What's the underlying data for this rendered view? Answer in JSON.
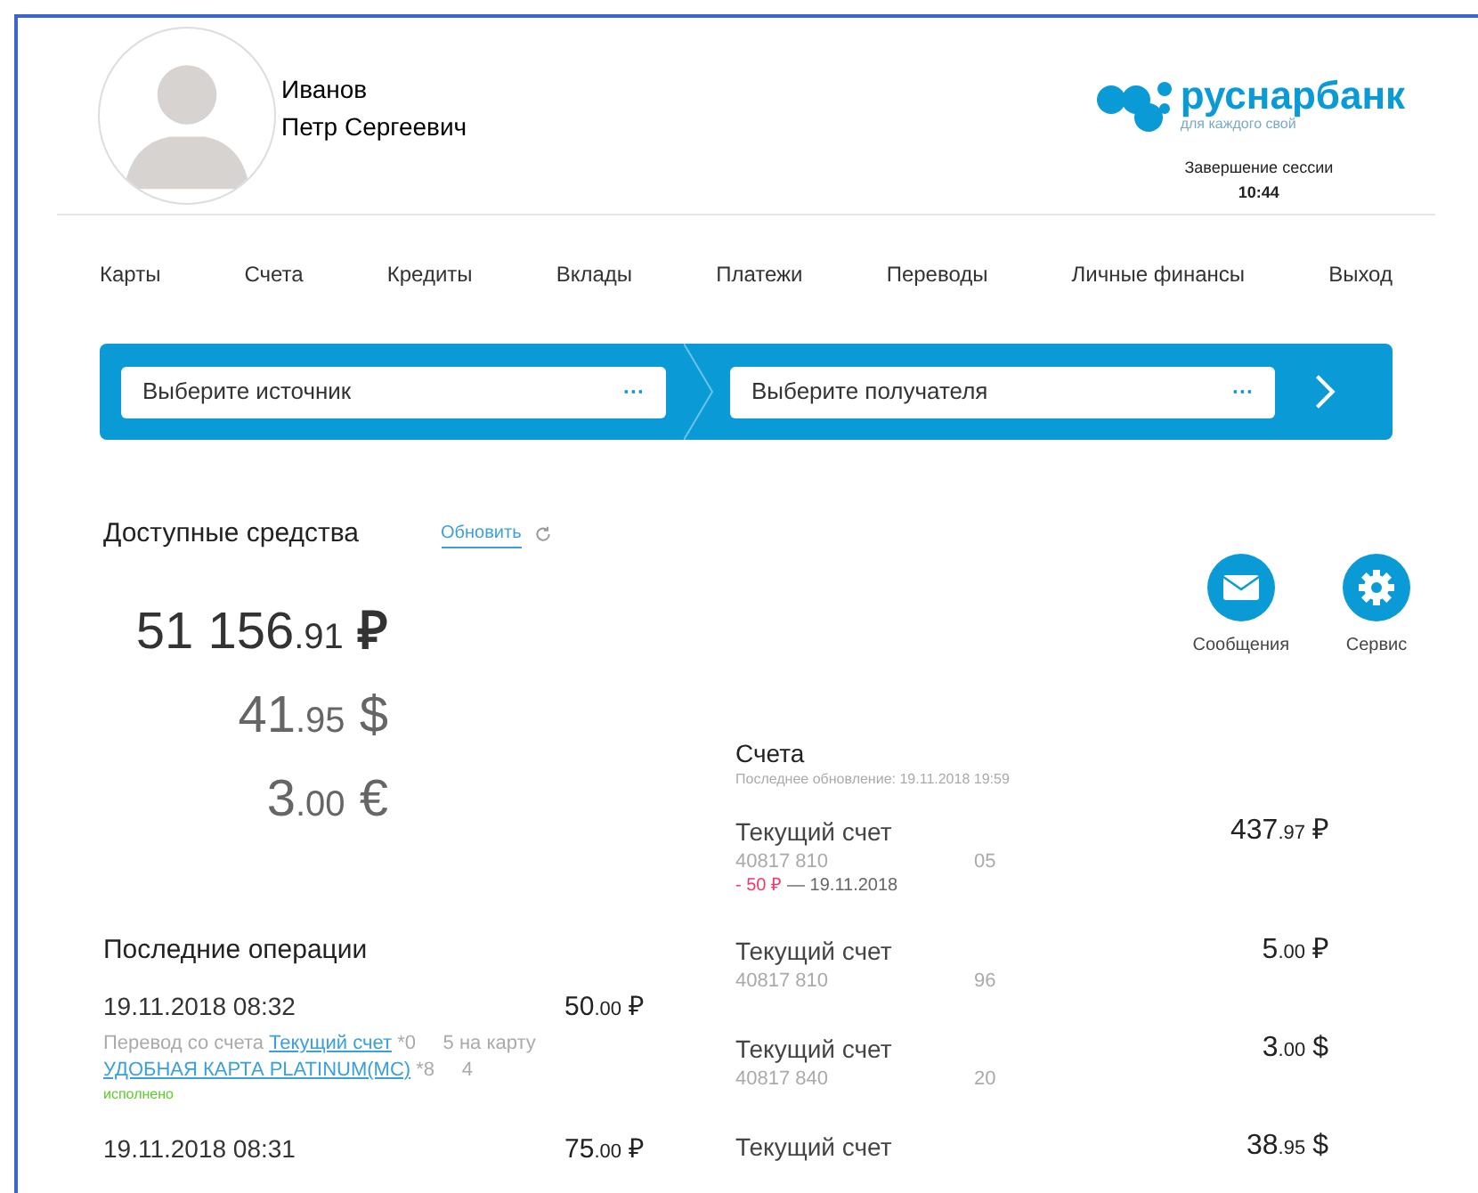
{
  "user": {
    "last_name": "Иванов",
    "first_and_middle_name": "Петр Сергеевич"
  },
  "logo": {
    "name": "руснарбанк",
    "tagline": "для каждого свой"
  },
  "session": {
    "label": "Завершение сессии",
    "time": "10:44"
  },
  "nav": [
    "Карты",
    "Счета",
    "Кредиты",
    "Вклады",
    "Платежи",
    "Переводы",
    "Личные финансы",
    "Выход"
  ],
  "transfer_bar": {
    "source_placeholder": "Выберите источник",
    "recipient_placeholder": "Выберите получателя",
    "more_source": "···",
    "more_recipient": "···"
  },
  "available_funds": {
    "title": "Доступные средства",
    "refresh_link": "Обновить",
    "amounts": [
      {
        "whole": "51 156",
        "fraction": ".91",
        "currency": "₽",
        "primary": true
      },
      {
        "whole": "41",
        "fraction": ".95",
        "currency": "$",
        "primary": false
      },
      {
        "whole": "3",
        "fraction": ".00",
        "currency": "€",
        "primary": false
      }
    ]
  },
  "quick_actions": [
    {
      "kind": "messages",
      "label": "Сообщения"
    },
    {
      "kind": "service",
      "label": "Сервис"
    }
  ],
  "accounts": {
    "title": "Счета",
    "updated": "Последнее обновление: 19.11.2018 19:59",
    "items": [
      {
        "name": "Текущий счет",
        "number": "40817 810",
        "number_end": "05",
        "whole": "437",
        "fraction": ".97",
        "currency": "₽",
        "change": "- 50 ₽",
        "change_date": "— 19.11.2018"
      },
      {
        "name": "Текущий счет",
        "number": "40817 810",
        "number_end": "96",
        "whole": "5",
        "fraction": ".00",
        "currency": "₽"
      },
      {
        "name": "Текущий счет",
        "number": "40817 840",
        "number_end": "20",
        "whole": "3",
        "fraction": ".00",
        "currency": "$"
      },
      {
        "name": "Текущий счет",
        "whole": "38",
        "fraction": ".95",
        "currency": "$"
      }
    ]
  },
  "operations": {
    "title": "Последние операции",
    "items": [
      {
        "datetime": "19.11.2018 08:32",
        "whole": "50",
        "fraction": ".00",
        "currency": "₽",
        "description": [
          {
            "kind": "text",
            "text": "Перевод со счета "
          },
          {
            "kind": "link",
            "text": "Текущий счет"
          },
          {
            "kind": "text",
            "text": " *0     5 на карту "
          },
          {
            "kind": "link",
            "text": "УДОБНАЯ КАРТА PLATINUM(MC)"
          },
          {
            "kind": "text",
            "text": " *8     4"
          }
        ],
        "status": "исполнено"
      },
      {
        "datetime": "19.11.2018 08:31",
        "whole": "75",
        "fraction": ".00",
        "currency": "₽"
      }
    ]
  }
}
